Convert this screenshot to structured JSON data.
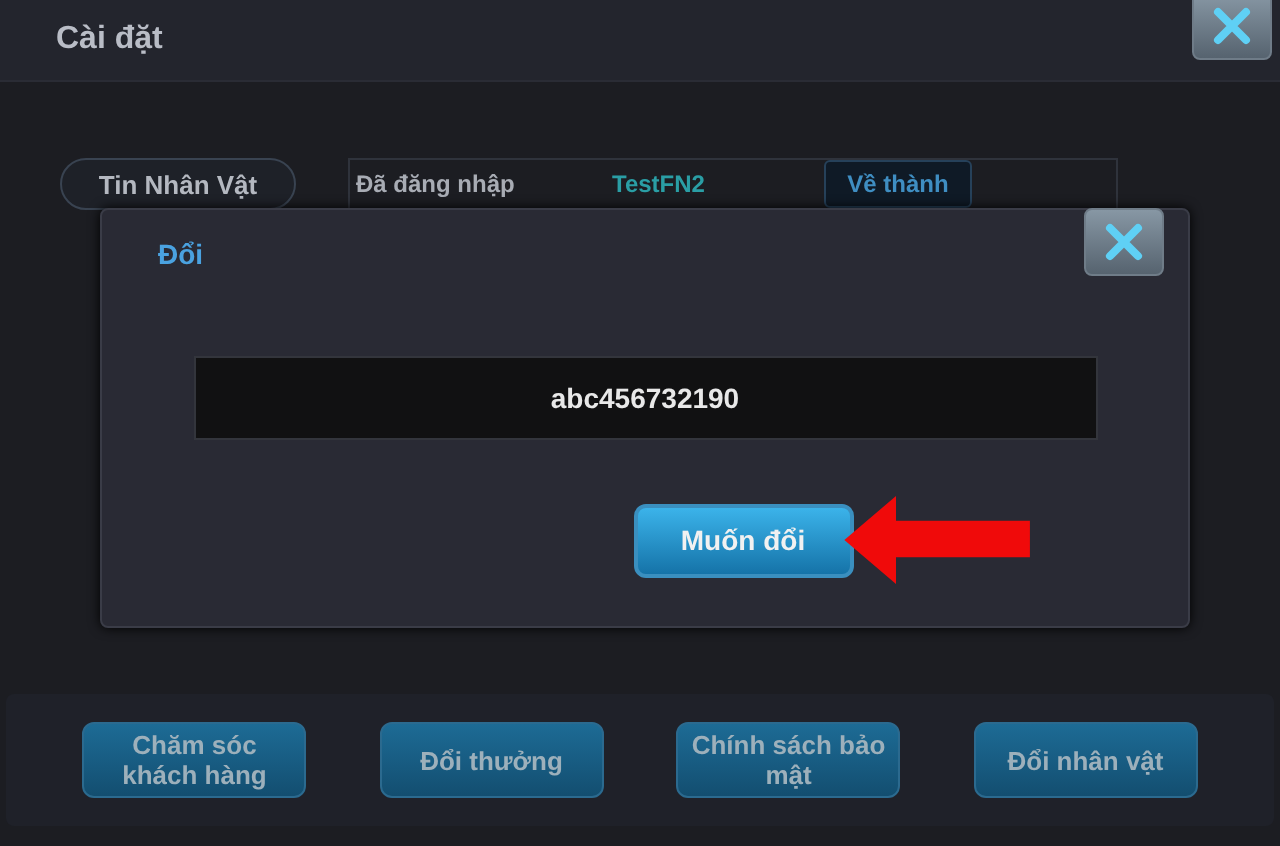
{
  "window": {
    "title": "Cài đặt"
  },
  "account": {
    "tab": "Tin Nhân Vật",
    "status": "Đã đăng nhập",
    "name": "TestFN2",
    "button": "Về thành"
  },
  "dialog": {
    "title": "Đổi",
    "field_value": "abc456732190",
    "button": "Muốn đổi"
  },
  "bottom_buttons": [
    "Chăm sóc khách hàng",
    "Đổi thưởng",
    "Chính sách bảo mật",
    "Đổi nhân vật"
  ]
}
